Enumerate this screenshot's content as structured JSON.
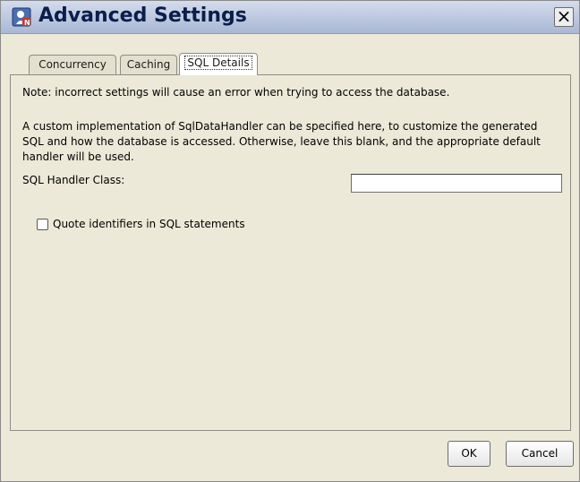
{
  "window": {
    "title": "Advanced Settings",
    "close_glyph": "×",
    "app_icon": "advanced-settings-icon"
  },
  "tabs": [
    {
      "label": "Concurrency",
      "active": false
    },
    {
      "label": "Caching",
      "active": false
    },
    {
      "label": "SQL Details",
      "active": true
    }
  ],
  "panel": {
    "note": "Note: incorrect settings will cause an error when trying to access the database.",
    "description": "A custom implementation of SqlDataHandler can be specified here, to customize the generated SQL and how the database is accessed. Otherwise, leave this blank, and the appropriate default handler will be used.",
    "handler_label": "SQL Handler Class:",
    "handler_value": "",
    "quote_label": "Quote identifiers in SQL statements",
    "quote_checked": false
  },
  "buttons": {
    "ok": "OK",
    "cancel": "Cancel"
  }
}
